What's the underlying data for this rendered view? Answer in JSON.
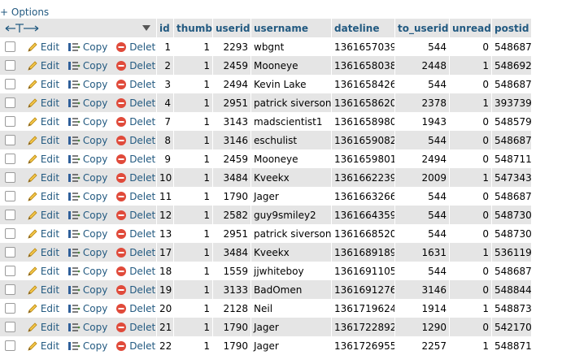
{
  "options_label": "+ Options",
  "header": {
    "id": "id",
    "thumb": "thumb",
    "userid": "userid",
    "username": "username",
    "dateline": "dateline",
    "to_userid": "to_userid",
    "unread": "unread",
    "postid": "postid"
  },
  "actions": {
    "edit": "Edit",
    "copy": "Copy",
    "delete": "Delete"
  },
  "rows": [
    {
      "id": "1",
      "thumb": "1",
      "userid": "2293",
      "username": "wbgnt",
      "dateline": "1361657039",
      "to_userid": "544",
      "unread": "0",
      "postid": "548687"
    },
    {
      "id": "2",
      "thumb": "1",
      "userid": "2459",
      "username": "Mooneye",
      "dateline": "1361658038",
      "to_userid": "2448",
      "unread": "1",
      "postid": "548692"
    },
    {
      "id": "3",
      "thumb": "1",
      "userid": "2494",
      "username": "Kevin Lake",
      "dateline": "1361658426",
      "to_userid": "544",
      "unread": "0",
      "postid": "548687"
    },
    {
      "id": "4",
      "thumb": "1",
      "userid": "2951",
      "username": "patrick siverson",
      "dateline": "1361658620",
      "to_userid": "2378",
      "unread": "1",
      "postid": "393739"
    },
    {
      "id": "7",
      "thumb": "1",
      "userid": "3143",
      "username": "madscientist1",
      "dateline": "1361658980",
      "to_userid": "1943",
      "unread": "0",
      "postid": "548579"
    },
    {
      "id": "8",
      "thumb": "1",
      "userid": "3146",
      "username": "eschulist",
      "dateline": "1361659082",
      "to_userid": "544",
      "unread": "0",
      "postid": "548687"
    },
    {
      "id": "9",
      "thumb": "1",
      "userid": "2459",
      "username": "Mooneye",
      "dateline": "1361659801",
      "to_userid": "2494",
      "unread": "0",
      "postid": "548711"
    },
    {
      "id": "10",
      "thumb": "1",
      "userid": "3484",
      "username": "Kveekx",
      "dateline": "1361662239",
      "to_userid": "2009",
      "unread": "1",
      "postid": "547343"
    },
    {
      "id": "11",
      "thumb": "1",
      "userid": "1790",
      "username": "Jager",
      "dateline": "1361663266",
      "to_userid": "544",
      "unread": "0",
      "postid": "548687"
    },
    {
      "id": "12",
      "thumb": "1",
      "userid": "2582",
      "username": "guy9smiley2",
      "dateline": "1361664359",
      "to_userid": "544",
      "unread": "0",
      "postid": "548730"
    },
    {
      "id": "13",
      "thumb": "1",
      "userid": "2951",
      "username": "patrick siverson",
      "dateline": "1361668520",
      "to_userid": "544",
      "unread": "0",
      "postid": "548730"
    },
    {
      "id": "17",
      "thumb": "1",
      "userid": "3484",
      "username": "Kveekx",
      "dateline": "1361689189",
      "to_userid": "1631",
      "unread": "1",
      "postid": "536119"
    },
    {
      "id": "18",
      "thumb": "1",
      "userid": "1559",
      "username": "jjwhiteboy",
      "dateline": "1361691105",
      "to_userid": "544",
      "unread": "0",
      "postid": "548687"
    },
    {
      "id": "19",
      "thumb": "1",
      "userid": "3133",
      "username": "BadOmen",
      "dateline": "1361691276",
      "to_userid": "3146",
      "unread": "0",
      "postid": "548844"
    },
    {
      "id": "20",
      "thumb": "1",
      "userid": "2128",
      "username": "Neil",
      "dateline": "1361719624",
      "to_userid": "1914",
      "unread": "1",
      "postid": "548873"
    },
    {
      "id": "21",
      "thumb": "1",
      "userid": "1790",
      "username": "Jager",
      "dateline": "1361722892",
      "to_userid": "1290",
      "unread": "0",
      "postid": "542170"
    },
    {
      "id": "22",
      "thumb": "1",
      "userid": "1790",
      "username": "Jager",
      "dateline": "1361726955",
      "to_userid": "2257",
      "unread": "1",
      "postid": "548871"
    }
  ]
}
